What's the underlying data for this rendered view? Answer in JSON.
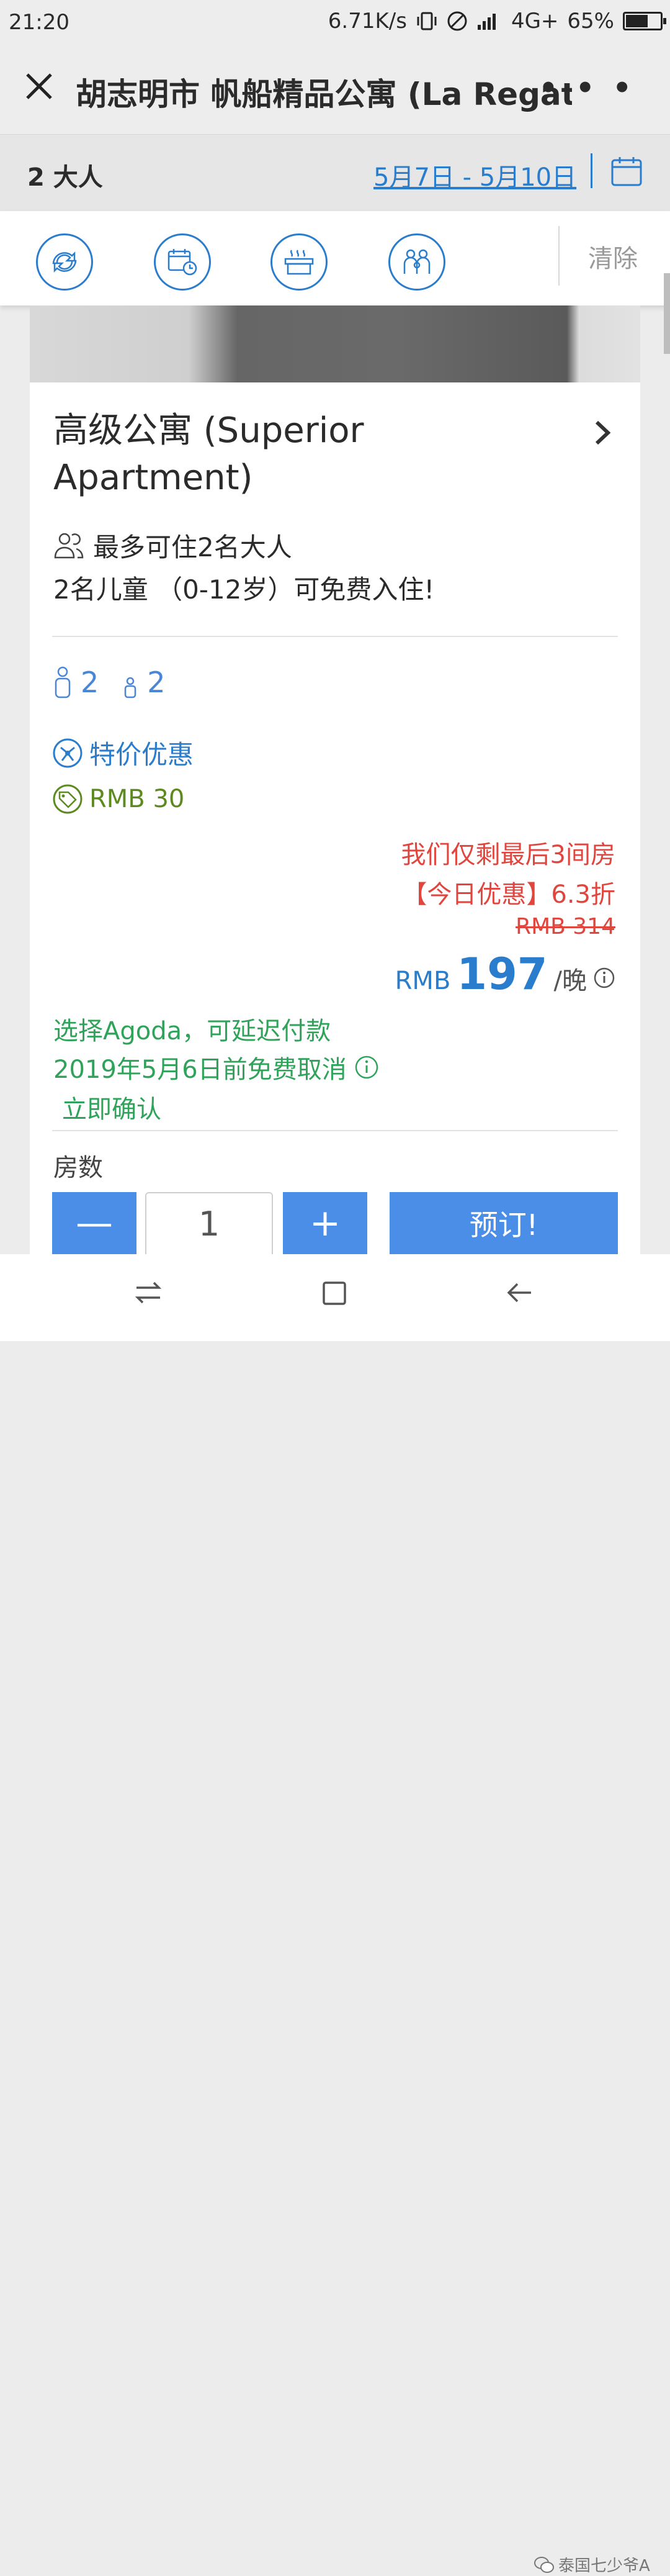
{
  "status": {
    "time": "21:20",
    "net_speed": "6.71K/s",
    "network": "4G+",
    "battery": "65%"
  },
  "header": {
    "title": "胡志明市 帆船精品公寓 (La Regat…",
    "more": "• • •"
  },
  "search": {
    "guests": "2 大人",
    "dates": "5月7日 - 5月10日"
  },
  "filters": {
    "clear": "清除"
  },
  "room": {
    "title": "高级公寓 (Superior Apartment)",
    "max_occupancy": "最多可住2名大人",
    "children": "2名儿童 （0-12岁）可免费入住!",
    "adults": "2",
    "kids": "2",
    "promo": "特价优惠",
    "coupon": "RMB 30",
    "scarcity": "我们仅剩最后3间房",
    "todays_deal": "【今日优惠】6.3折",
    "original_price": "RMB 314",
    "currency": "RMB",
    "price": "197",
    "per_night": "/晚",
    "pay_later": "选择Agoda，可延迟付款",
    "free_cancel": "2019年5月6日前免费取消",
    "instant": "立即确认",
    "rooms_label": "房数",
    "quantity": "1",
    "minus": "—",
    "plus": "+",
    "book": "预订!"
  },
  "watermark": "泰国七少爷A",
  "colors": {
    "accent": "#2a7ccc",
    "button": "#4a8ee8",
    "red": "#e0463d",
    "green": "#2fa35a",
    "coupon": "#5c8a1e"
  }
}
